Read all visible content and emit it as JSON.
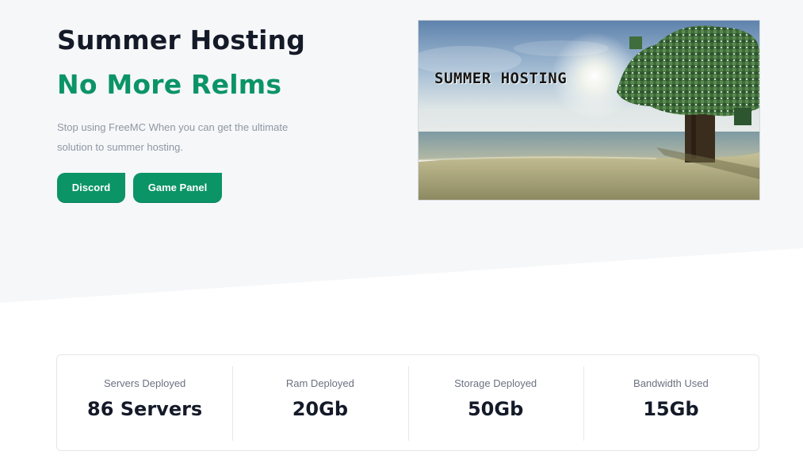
{
  "hero": {
    "title": "Summer Hosting",
    "subtitle": "No More Relms",
    "description": "Stop using FreeMC When you can get the ultimate solution to summer hosting.",
    "buttons": [
      {
        "label": "Discord"
      },
      {
        "label": "Game Panel"
      }
    ],
    "banner_text": "SUMMER HOSTING"
  },
  "stats": [
    {
      "label": "Servers Deployed",
      "value": "86 Servers"
    },
    {
      "label": "Ram Deployed",
      "value": "20Gb"
    },
    {
      "label": "Storage Deployed",
      "value": "50Gb"
    },
    {
      "label": "Bandwidth Used",
      "value": "15Gb"
    }
  ],
  "colors": {
    "accent": "#0b9466",
    "hero_background": "#f6f7f9",
    "heading": "#141a28",
    "muted_text": "#8f97a3"
  }
}
